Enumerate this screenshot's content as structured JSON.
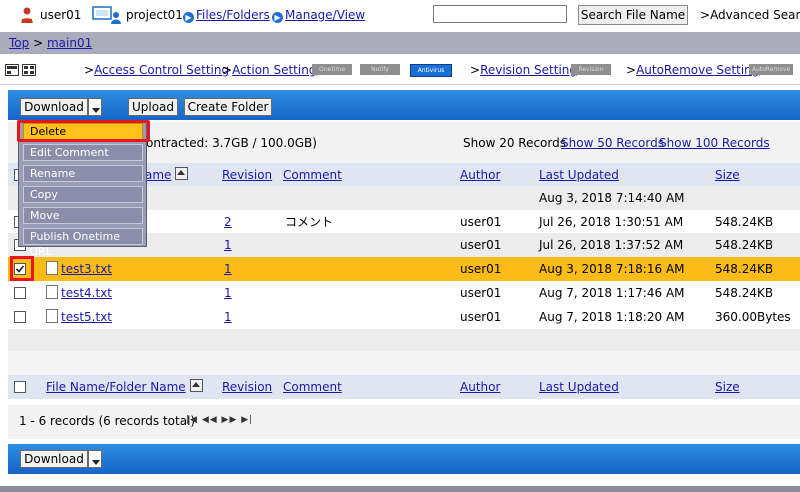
{
  "header": {
    "user": "user01",
    "project": "project01",
    "nav_files": "Files/Folders",
    "nav_manage": "Manage/View",
    "search_value": "",
    "search_button": "Search File Name",
    "advanced_search": "Advanced Search"
  },
  "breadcrumb": {
    "top": "Top",
    "sep": ">",
    "current": "main01"
  },
  "settings": {
    "access_control": "Access Control Setting",
    "action": "Action Setting",
    "onetime": "Onetime",
    "notify": "Notify",
    "antivirus": "Antivirus",
    "revision_setting": "Revision Setting",
    "revision": "Revision",
    "autoremove_setting": "AutoRemove Setting",
    "autoremove": "AutoRemove"
  },
  "toolbar": {
    "download": "Download",
    "upload": "Upload",
    "create_folder": "Create Folder"
  },
  "menu": {
    "items": [
      "Delete",
      "Edit Comment",
      "Rename",
      "Copy",
      "Move",
      "Publish Onetime URL"
    ]
  },
  "info": {
    "contracted": "ontracted: 3.7GB / 100.0GB)",
    "show_label": "Show 20 Records",
    "show_50": "Show 50 Records",
    "show_100": "Show 100 Records"
  },
  "columns": {
    "name": "File Name/Folder Name",
    "name_partial": "ame",
    "revision": "Revision",
    "comment": "Comment",
    "author": "Author",
    "last_updated": "Last Updated",
    "size": "Size"
  },
  "rows": [
    {
      "name": "",
      "revision": "",
      "comment": "",
      "author": "",
      "updated": "Aug 3, 2018 7:14:40 AM",
      "size": "",
      "checked": false
    },
    {
      "name": "",
      "revision": "2",
      "comment": "コメント",
      "author": "user01",
      "updated": "Jul 26, 2018 1:30:51 AM",
      "size": "548.24KB",
      "checked": false
    },
    {
      "name": "",
      "revision": "1",
      "comment": "",
      "author": "user01",
      "updated": "Jul 26, 2018 1:37:52 AM",
      "size": "548.24KB",
      "checked": false
    },
    {
      "name": "test3.txt",
      "revision": "1",
      "comment": "",
      "author": "user01",
      "updated": "Aug 3, 2018 7:18:16 AM",
      "size": "548.24KB",
      "checked": true
    },
    {
      "name": "test4.txt",
      "revision": "1",
      "comment": "",
      "author": "user01",
      "updated": "Aug 7, 2018 1:17:46 AM",
      "size": "548.24KB",
      "checked": false
    },
    {
      "name": "test5.txt",
      "revision": "1",
      "comment": "",
      "author": "user01",
      "updated": "Aug 7, 2018 1:18:20 AM",
      "size": "360.00Bytes",
      "checked": false
    }
  ],
  "footer": {
    "records": "1 - 6 records (6 records total)",
    "pager": "|◀  ◀◀    ▶▶  ▶|"
  },
  "colors": {
    "accent": "#1b6fd8",
    "selected": "#fcbc17",
    "highlight": "#e8141e"
  }
}
